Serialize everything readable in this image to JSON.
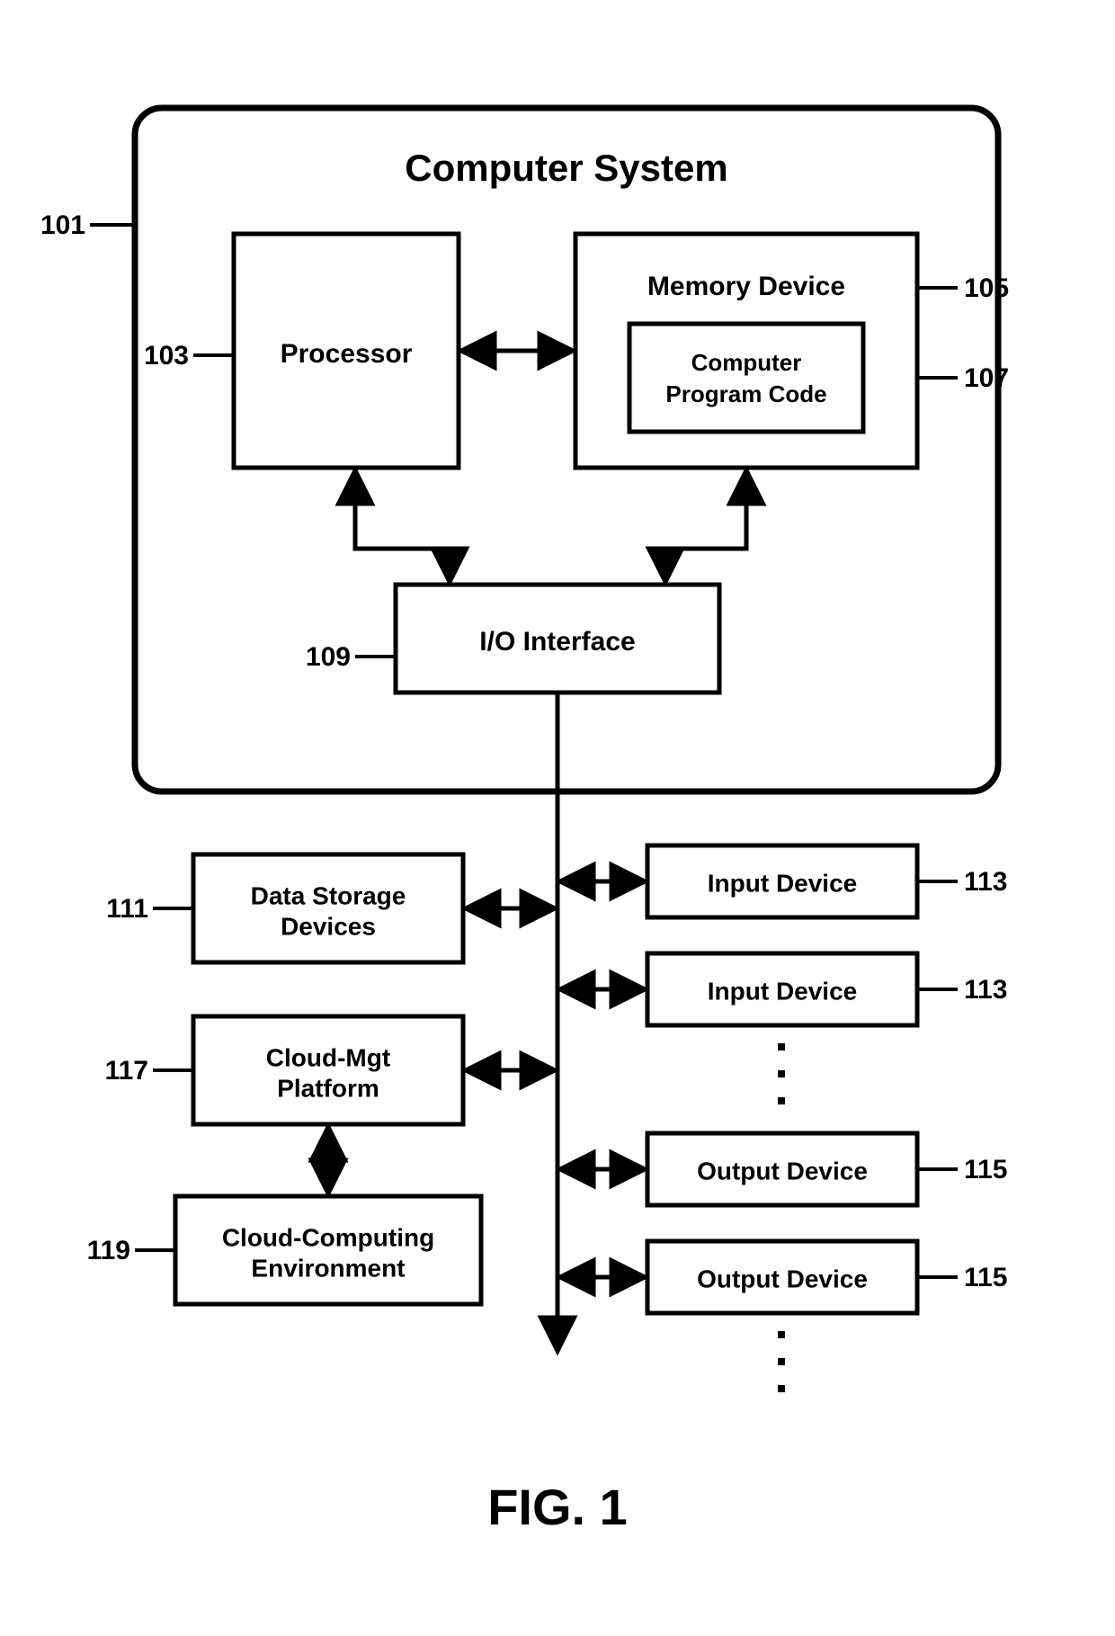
{
  "figure": {
    "caption": "FIG. 1"
  },
  "system": {
    "title": "Computer System",
    "processor": "Processor",
    "memory": "Memory Device",
    "program_code_l1": "Computer",
    "program_code_l2": "Program Code",
    "io_interface": "I/O Interface"
  },
  "peripherals": {
    "data_storage_l1": "Data Storage",
    "data_storage_l2": "Devices",
    "cloud_mgt_l1": "Cloud-Mgt",
    "cloud_mgt_l2": "Platform",
    "cloud_env_l1": "Cloud-Computing",
    "cloud_env_l2": "Environment",
    "input_device": "Input Device",
    "output_device": "Output Device"
  },
  "refs": {
    "system": "101",
    "processor": "103",
    "memory": "105",
    "program_code": "107",
    "io_interface": "109",
    "data_storage": "111",
    "input_device": "113",
    "output_device": "115",
    "cloud_mgt": "117",
    "cloud_env": "119"
  }
}
